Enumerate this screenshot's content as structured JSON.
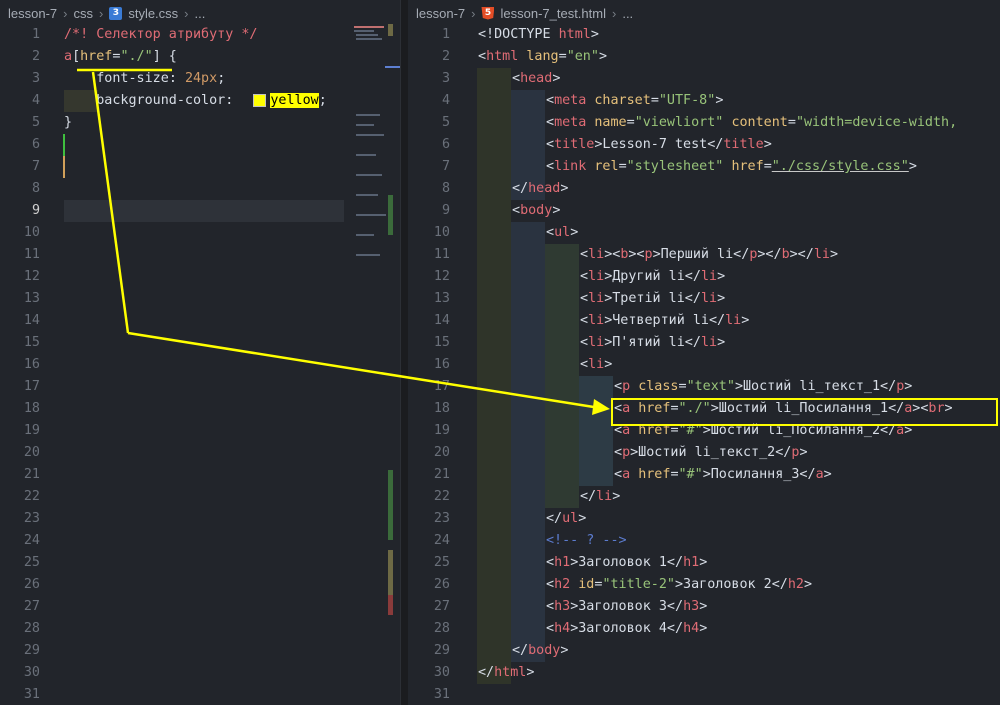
{
  "left": {
    "breadcrumb": {
      "folder": "lesson-7",
      "subfolder": "css",
      "file": "style.css",
      "more": "..."
    },
    "line_numbers": [
      "1",
      "2",
      "3",
      "4",
      "5",
      "6",
      "7",
      "8",
      "9",
      "10",
      "11",
      "12",
      "13",
      "14",
      "15",
      "16",
      "17",
      "18",
      "19",
      "20",
      "21",
      "22",
      "23",
      "24",
      "25",
      "26",
      "27",
      "28",
      "29",
      "30",
      "31"
    ],
    "current_line": "9",
    "code": {
      "comment": "/*! Селектор атрибуту */",
      "sel_a": "a",
      "sel_open": "[",
      "sel_attr": "href",
      "sel_eq": "=",
      "sel_val": "\"./\"",
      "sel_close": "]",
      "brace_open": " {",
      "prop1": "font-size",
      "colon1": ": ",
      "val1": "24px",
      "semi1": ";",
      "prop2": "background-color",
      "colon2": ": ",
      "val2": "yellow",
      "semi2": ";",
      "brace_close": "}"
    }
  },
  "right": {
    "breadcrumb": {
      "folder": "lesson-7",
      "file": "lesson-7_test.html",
      "more": "..."
    },
    "line_numbers": [
      "1",
      "2",
      "3",
      "4",
      "5",
      "6",
      "7",
      "8",
      "9",
      "10",
      "11",
      "12",
      "13",
      "14",
      "15",
      "16",
      "17",
      "18",
      "19",
      "20",
      "21",
      "22",
      "23",
      "24",
      "25",
      "26",
      "27",
      "28",
      "29",
      "30",
      "31"
    ],
    "lines": [
      [
        [
          "p",
          "<!DOCTYPE "
        ],
        [
          "k",
          "html"
        ],
        [
          "p",
          ">"
        ]
      ],
      [
        [
          "p",
          "<"
        ],
        [
          "k",
          "html "
        ],
        [
          "n",
          "lang"
        ],
        [
          "p",
          "="
        ],
        [
          "s",
          "\"en\""
        ],
        [
          "p",
          ">"
        ]
      ],
      [
        [
          "p",
          "<"
        ],
        [
          "k",
          "head"
        ],
        [
          "p",
          ">"
        ]
      ],
      [
        [
          "p",
          "<"
        ],
        [
          "k",
          "meta "
        ],
        [
          "n",
          "charset"
        ],
        [
          "p",
          "="
        ],
        [
          "s",
          "\"UTF-8\""
        ],
        [
          "p",
          ">"
        ]
      ],
      [
        [
          "p",
          "<"
        ],
        [
          "k",
          "meta "
        ],
        [
          "n",
          "name"
        ],
        [
          "p",
          "="
        ],
        [
          "s",
          "\"viewliort\" "
        ],
        [
          "n",
          "content"
        ],
        [
          "p",
          "="
        ],
        [
          "s",
          "\"width=device-width,"
        ]
      ],
      [
        [
          "p",
          "<"
        ],
        [
          "k",
          "title"
        ],
        [
          "p",
          ">Lesson-7 test</"
        ],
        [
          "k",
          "title"
        ],
        [
          "p",
          ">"
        ]
      ],
      [
        [
          "p",
          "<"
        ],
        [
          "k",
          "link "
        ],
        [
          "n",
          "rel"
        ],
        [
          "p",
          "="
        ],
        [
          "s",
          "\"stylesheet\" "
        ],
        [
          "n",
          "href"
        ],
        [
          "p",
          "="
        ],
        [
          "su",
          "\"./css/style.css\""
        ],
        [
          "p",
          ">"
        ]
      ],
      [
        [
          "p",
          "</"
        ],
        [
          "k",
          "head"
        ],
        [
          "p",
          ">"
        ]
      ],
      [
        [
          "p",
          "<"
        ],
        [
          "k",
          "body"
        ],
        [
          "p",
          ">"
        ]
      ],
      [
        [
          "p",
          "<"
        ],
        [
          "k",
          "ul"
        ],
        [
          "p",
          ">"
        ]
      ],
      [
        [
          "p",
          "<"
        ],
        [
          "k",
          "li"
        ],
        [
          "p",
          "><"
        ],
        [
          "k",
          "b"
        ],
        [
          "p",
          "><"
        ],
        [
          "k",
          "p"
        ],
        [
          "p",
          ">Перший li</"
        ],
        [
          "k",
          "p"
        ],
        [
          "p",
          "></"
        ],
        [
          "k",
          "b"
        ],
        [
          "p",
          "></"
        ],
        [
          "k",
          "li"
        ],
        [
          "p",
          ">"
        ]
      ],
      [
        [
          "p",
          "<"
        ],
        [
          "k",
          "li"
        ],
        [
          "p",
          ">Другий li</"
        ],
        [
          "k",
          "li"
        ],
        [
          "p",
          ">"
        ]
      ],
      [
        [
          "p",
          "<"
        ],
        [
          "k",
          "li"
        ],
        [
          "p",
          ">Третій li</"
        ],
        [
          "k",
          "li"
        ],
        [
          "p",
          ">"
        ]
      ],
      [
        [
          "p",
          "<"
        ],
        [
          "k",
          "li"
        ],
        [
          "p",
          ">Четвертий li</"
        ],
        [
          "k",
          "li"
        ],
        [
          "p",
          ">"
        ]
      ],
      [
        [
          "p",
          "<"
        ],
        [
          "k",
          "li"
        ],
        [
          "p",
          ">П'ятий li</"
        ],
        [
          "k",
          "li"
        ],
        [
          "p",
          ">"
        ]
      ],
      [
        [
          "p",
          "<"
        ],
        [
          "k",
          "li"
        ],
        [
          "p",
          ">"
        ]
      ],
      [
        [
          "p",
          "<"
        ],
        [
          "k",
          "p "
        ],
        [
          "n",
          "class"
        ],
        [
          "p",
          "="
        ],
        [
          "s",
          "\"text\""
        ],
        [
          "p",
          ">Шостий li_текст_1</"
        ],
        [
          "k",
          "p"
        ],
        [
          "p",
          ">"
        ]
      ],
      [
        [
          "p",
          "<"
        ],
        [
          "k",
          "a "
        ],
        [
          "n",
          "href"
        ],
        [
          "p",
          "="
        ],
        [
          "s",
          "\"./\""
        ],
        [
          "p",
          ">Шостий li_Посилання_1</"
        ],
        [
          "k",
          "a"
        ],
        [
          "p",
          "><"
        ],
        [
          "k",
          "br"
        ],
        [
          "p",
          ">"
        ]
      ],
      [
        [
          "p",
          "<"
        ],
        [
          "k",
          "a "
        ],
        [
          "n",
          "href"
        ],
        [
          "p",
          "="
        ],
        [
          "s",
          "\"#\""
        ],
        [
          "p",
          ">Шостий li_Посилання_2</"
        ],
        [
          "k",
          "a"
        ],
        [
          "p",
          ">"
        ]
      ],
      [
        [
          "p",
          "<"
        ],
        [
          "k",
          "p"
        ],
        [
          "p",
          ">Шостий li_текст_2</"
        ],
        [
          "k",
          "p"
        ],
        [
          "p",
          ">"
        ]
      ],
      [
        [
          "p",
          "<"
        ],
        [
          "k",
          "a "
        ],
        [
          "n",
          "href"
        ],
        [
          "p",
          "="
        ],
        [
          "s",
          "\"#\""
        ],
        [
          "p",
          ">Посилання_3</"
        ],
        [
          "k",
          "a"
        ],
        [
          "p",
          ">"
        ]
      ],
      [
        [
          "p",
          "</"
        ],
        [
          "k",
          "li"
        ],
        [
          "p",
          ">"
        ]
      ],
      [
        [
          "p",
          "</"
        ],
        [
          "k",
          "ul"
        ],
        [
          "p",
          ">"
        ]
      ],
      [
        [
          "cm",
          "<!-- ? -->"
        ]
      ],
      [
        [
          "p",
          "<"
        ],
        [
          "k",
          "h1"
        ],
        [
          "p",
          ">Заголовок 1</"
        ],
        [
          "k",
          "h1"
        ],
        [
          "p",
          ">"
        ]
      ],
      [
        [
          "p",
          "<"
        ],
        [
          "k",
          "h2 "
        ],
        [
          "n",
          "id"
        ],
        [
          "p",
          "="
        ],
        [
          "s",
          "\"title-2\""
        ],
        [
          "p",
          ">Заголовок 2</"
        ],
        [
          "k",
          "h2"
        ],
        [
          "p",
          ">"
        ]
      ],
      [
        [
          "p",
          "<"
        ],
        [
          "k",
          "h3"
        ],
        [
          "p",
          ">Заголовок 3</"
        ],
        [
          "k",
          "h3"
        ],
        [
          "p",
          ">"
        ]
      ],
      [
        [
          "p",
          "<"
        ],
        [
          "k",
          "h4"
        ],
        [
          "p",
          ">Заголовок 4</"
        ],
        [
          "k",
          "h4"
        ],
        [
          "p",
          ">"
        ]
      ],
      [
        [
          "p",
          "</"
        ],
        [
          "k",
          "body"
        ],
        [
          "p",
          ">"
        ]
      ],
      [
        [
          "p",
          "</"
        ],
        [
          "k",
          "html"
        ],
        [
          "p",
          ">"
        ]
      ],
      []
    ]
  },
  "colors": {
    "annotation": "#ffff00",
    "tag": "#e06c75",
    "string": "#98c379",
    "attr": "#e5c07b"
  }
}
